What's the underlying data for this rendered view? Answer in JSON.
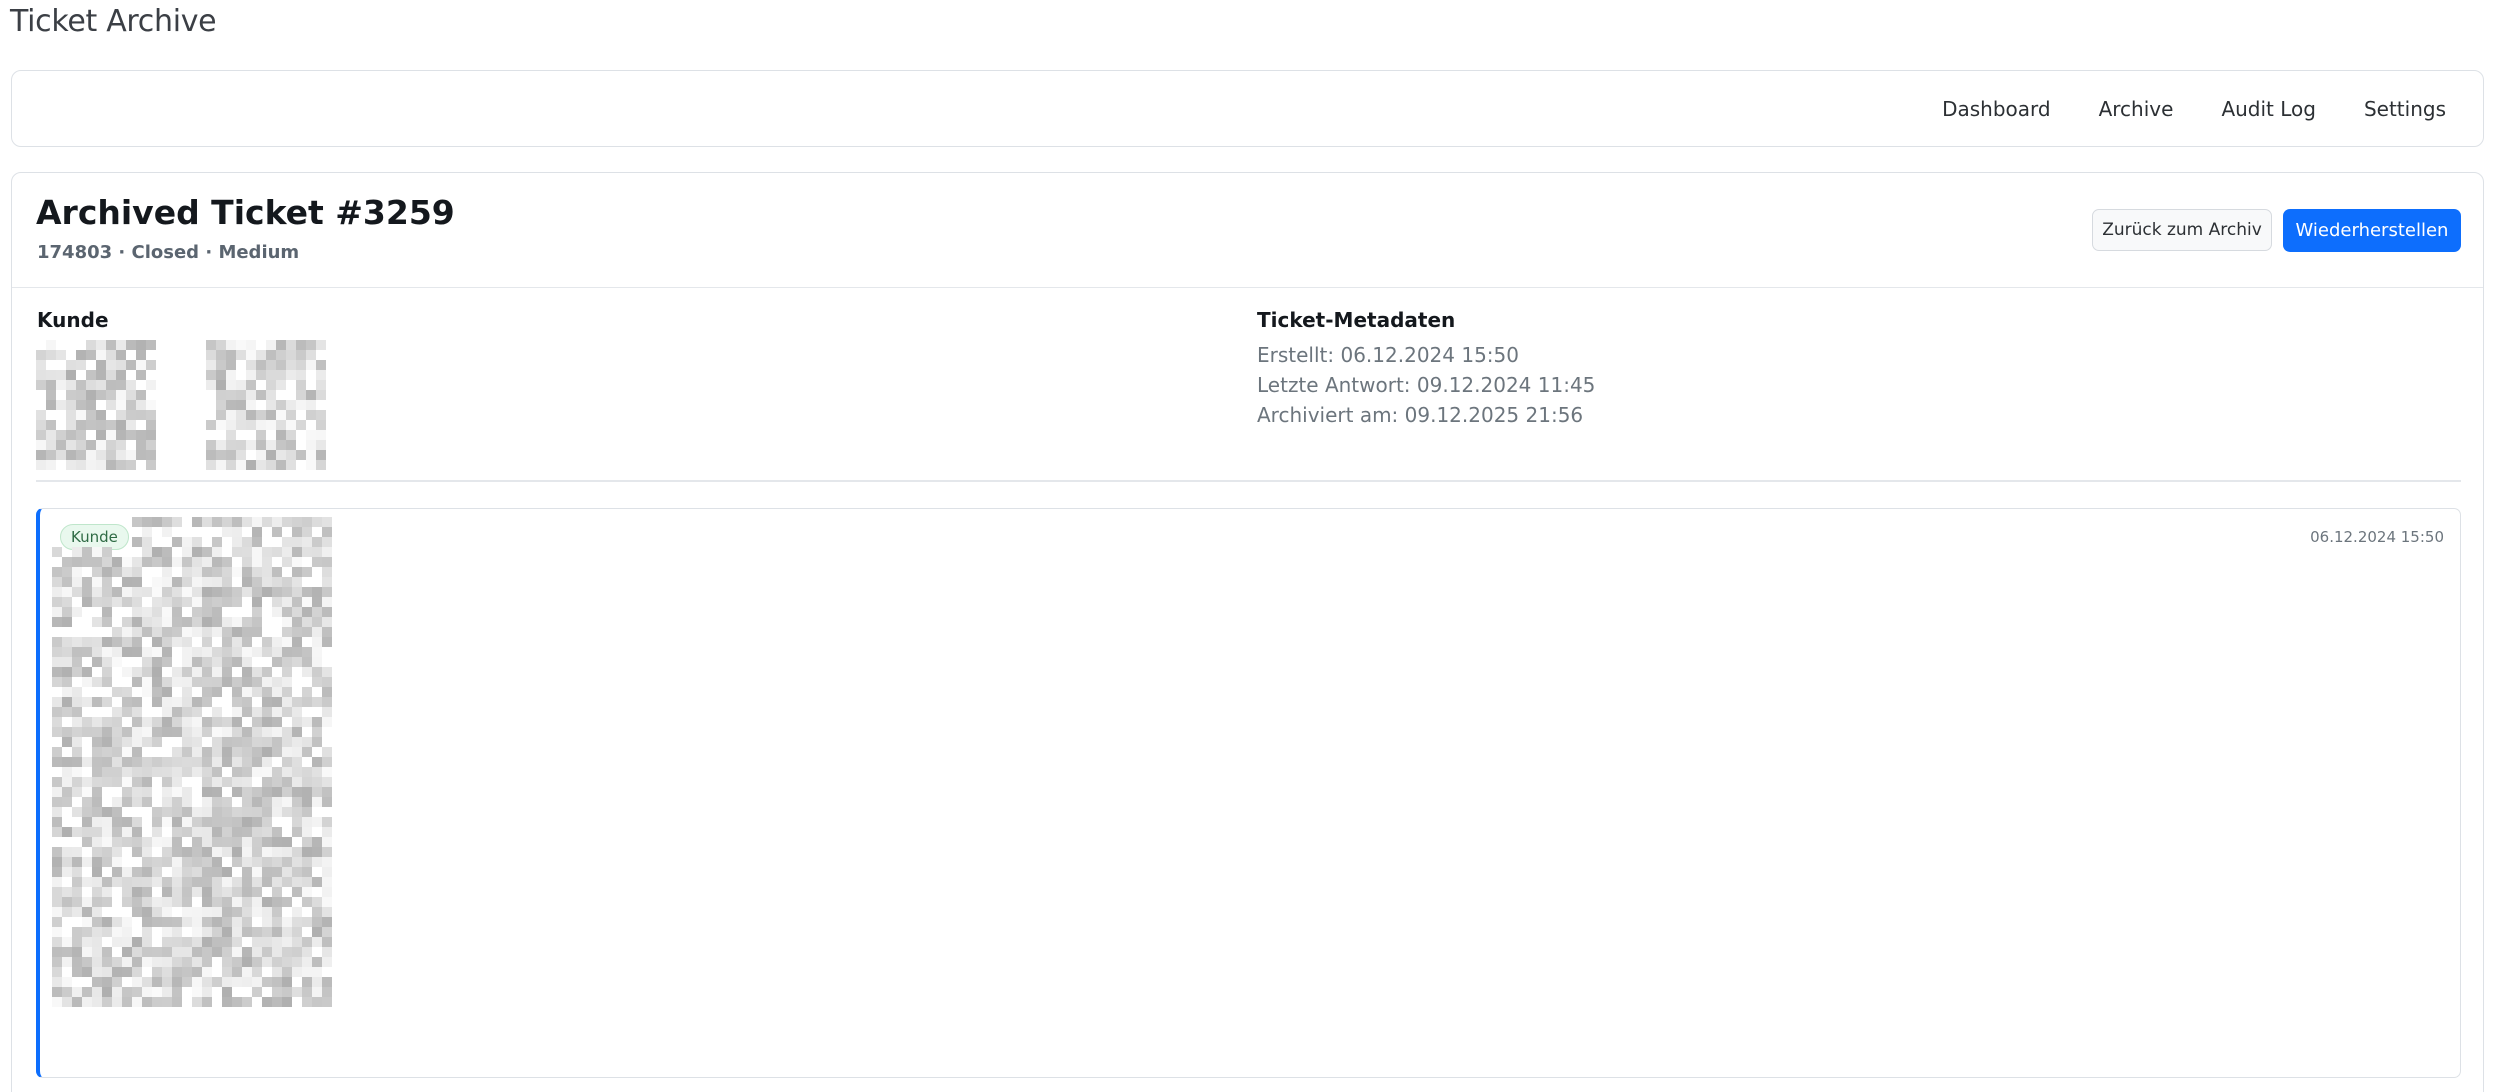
{
  "app": {
    "title": "Ticket Archive"
  },
  "nav": {
    "items": [
      "Dashboard",
      "Archive",
      "Audit Log",
      "Settings"
    ]
  },
  "ticket": {
    "title": "Archived Ticket #3259",
    "subtitle": "174803 · Closed · Medium",
    "back_label": "Zurück zum Archiv",
    "restore_label": "Wiederherstellen"
  },
  "customer": {
    "heading": "Kunde"
  },
  "metadata": {
    "heading": "Ticket-Metadaten",
    "created": "Erstellt: 06.12.2024 15:50",
    "last_reply": "Letzte Antwort: 09.12.2024 11:45",
    "archived": "Archiviert am: 09.12.2025 21:56"
  },
  "message": {
    "badge": "Kunde",
    "timestamp": "06.12.2024 15:50"
  },
  "colors": {
    "accent": "#0d6efd",
    "badge_bg": "#e9f8ee",
    "badge_text": "#2f6b45"
  }
}
